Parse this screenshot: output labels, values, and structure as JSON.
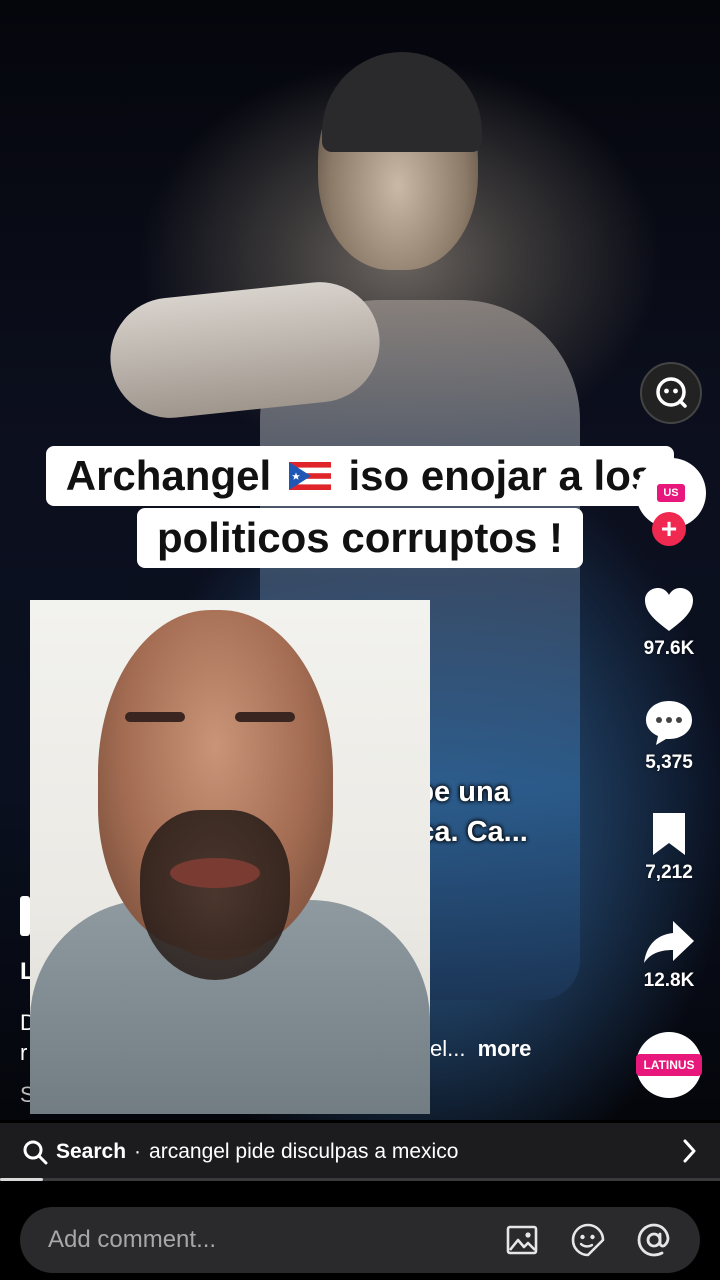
{
  "caption": {
    "line1_start": "Archangel",
    "line1_end": "iso enojar a los",
    "line2": "politicos corruptos !",
    "flag_icon": "puerto-rico-flag-icon"
  },
  "video_subtitle": {
    "line1": "ia le debe una",
    "line2": "América. Ca..."
  },
  "description": {
    "fragments": [
      "L",
      "D",
      "r",
      "S"
    ],
    "truncated_tail": "el...",
    "more_label": "more"
  },
  "rail": {
    "avatar_badge": "US",
    "likes": "97.6K",
    "comments": "5,375",
    "saves": "7,212",
    "shares": "12.8K",
    "music_badge": "LATINUS"
  },
  "search": {
    "label": "Search",
    "separator": "·",
    "query": "arcangel pide disculpas a mexico"
  },
  "progress": {
    "fraction": 0.06
  },
  "comment": {
    "placeholder": "Add comment..."
  },
  "colors": {
    "accent_red": "#ef2950",
    "brand_pink": "#e8177b",
    "search_bg": "#1c1c1e",
    "comment_input_bg": "#2a2a2c"
  }
}
